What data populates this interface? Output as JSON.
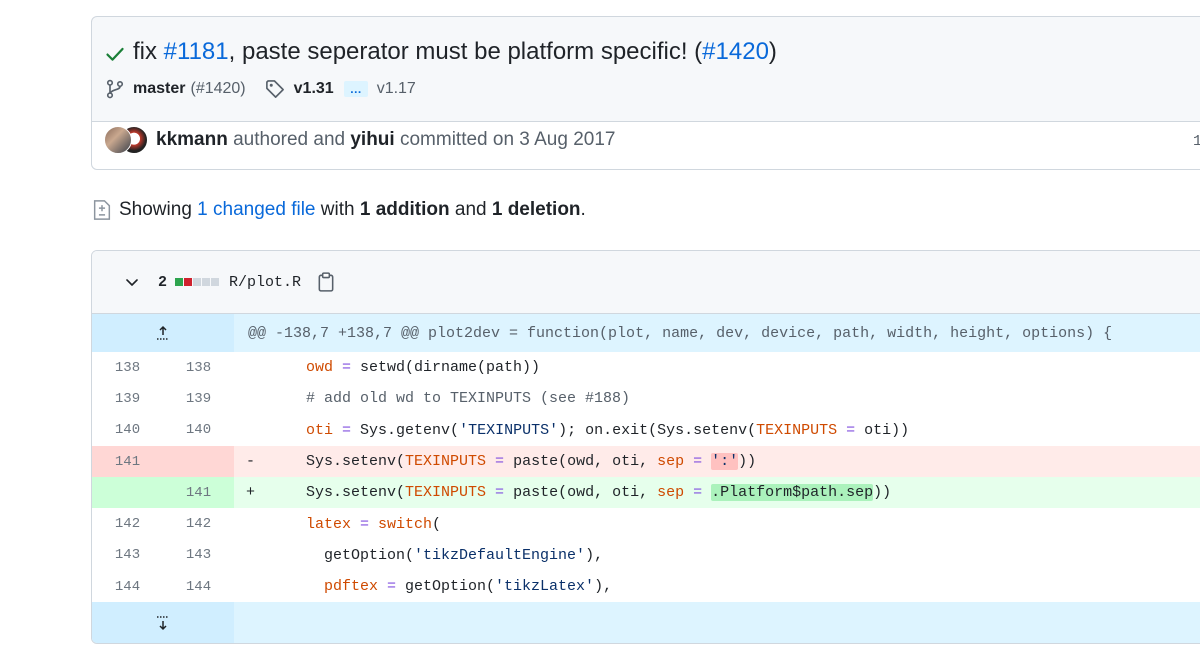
{
  "commit": {
    "title_prefix": "fix ",
    "issue_link": "#1181",
    "title_middle": ", paste seperator must be platform specific! (",
    "pr_link": "#1420",
    "title_suffix": ")",
    "branch": "master",
    "branch_pr": "(#1420)",
    "tag_latest": "v1.31",
    "tag_ellipsis": "…",
    "tag_oldest": "v1.17",
    "author": "kkmann",
    "authored_text": " authored and ",
    "committer": "yihui",
    "committed_text": " committed on 3 Aug 2017",
    "parent_count": "1"
  },
  "summary": {
    "prefix": "Showing ",
    "changed_files": "1 changed file",
    "with_text": " with ",
    "additions": "1 addition",
    "and_text": " and ",
    "deletions": "1 deletion",
    "suffix": "."
  },
  "file": {
    "change_count": "2",
    "name": "R/plot.R",
    "diffstat": {
      "added": 1,
      "deleted": 1,
      "neutral": 3
    },
    "colors": {
      "added": "#2da44e",
      "deleted": "#cf222e",
      "neutral": "#d0d7de"
    }
  },
  "diff": {
    "hunk_header": "@@ -138,7 +138,7 @@ plot2dev = function(plot, name, dev, device, path, width, height, options) {",
    "lines": [
      {
        "old": "138",
        "new": "138",
        "marker": ""
      },
      {
        "old": "139",
        "new": "139",
        "marker": ""
      },
      {
        "old": "140",
        "new": "140",
        "marker": ""
      },
      {
        "old": "141",
        "new": "",
        "marker": "-"
      },
      {
        "old": "",
        "new": "141",
        "marker": "+"
      },
      {
        "old": "142",
        "new": "142",
        "marker": ""
      },
      {
        "old": "143",
        "new": "143",
        "marker": ""
      },
      {
        "old": "144",
        "new": "144",
        "marker": ""
      }
    ],
    "code": {
      "l0": {
        "a": "owd",
        "b": " = ",
        "c": "setwd(dirname(path))"
      },
      "l1": {
        "a": "# add old wd to TEXINPUTS (see #188)"
      },
      "l2": {
        "a": "oti",
        "b": " = ",
        "c": "Sys.getenv(",
        "d": "'TEXINPUTS'",
        "e": "); on.exit(Sys.setenv(",
        "f": "TEXINPUTS",
        "g": " = ",
        "h": "oti))"
      },
      "l3": {
        "a": "Sys.setenv(",
        "b": "TEXINPUTS",
        "c": " = ",
        "d": "paste(owd, oti, ",
        "e": "sep",
        "f": " = ",
        "g": "':'",
        "h": "))"
      },
      "l4": {
        "a": "Sys.setenv(",
        "b": "TEXINPUTS",
        "c": " = ",
        "d": "paste(owd, oti, ",
        "e": "sep",
        "f": " = ",
        "g": ".Platform$path.sep",
        "h": "))"
      },
      "l5": {
        "a": "latex",
        "b": " = ",
        "c": "switch",
        "d": "("
      },
      "l6": {
        "a": "  getOption(",
        "b": "'tikzDefaultEngine'",
        "c": "),"
      },
      "l7": {
        "a": "  pdftex",
        "b": " = ",
        "c": "getOption(",
        "d": "'tikzLatex'",
        "e": "),"
      }
    }
  }
}
